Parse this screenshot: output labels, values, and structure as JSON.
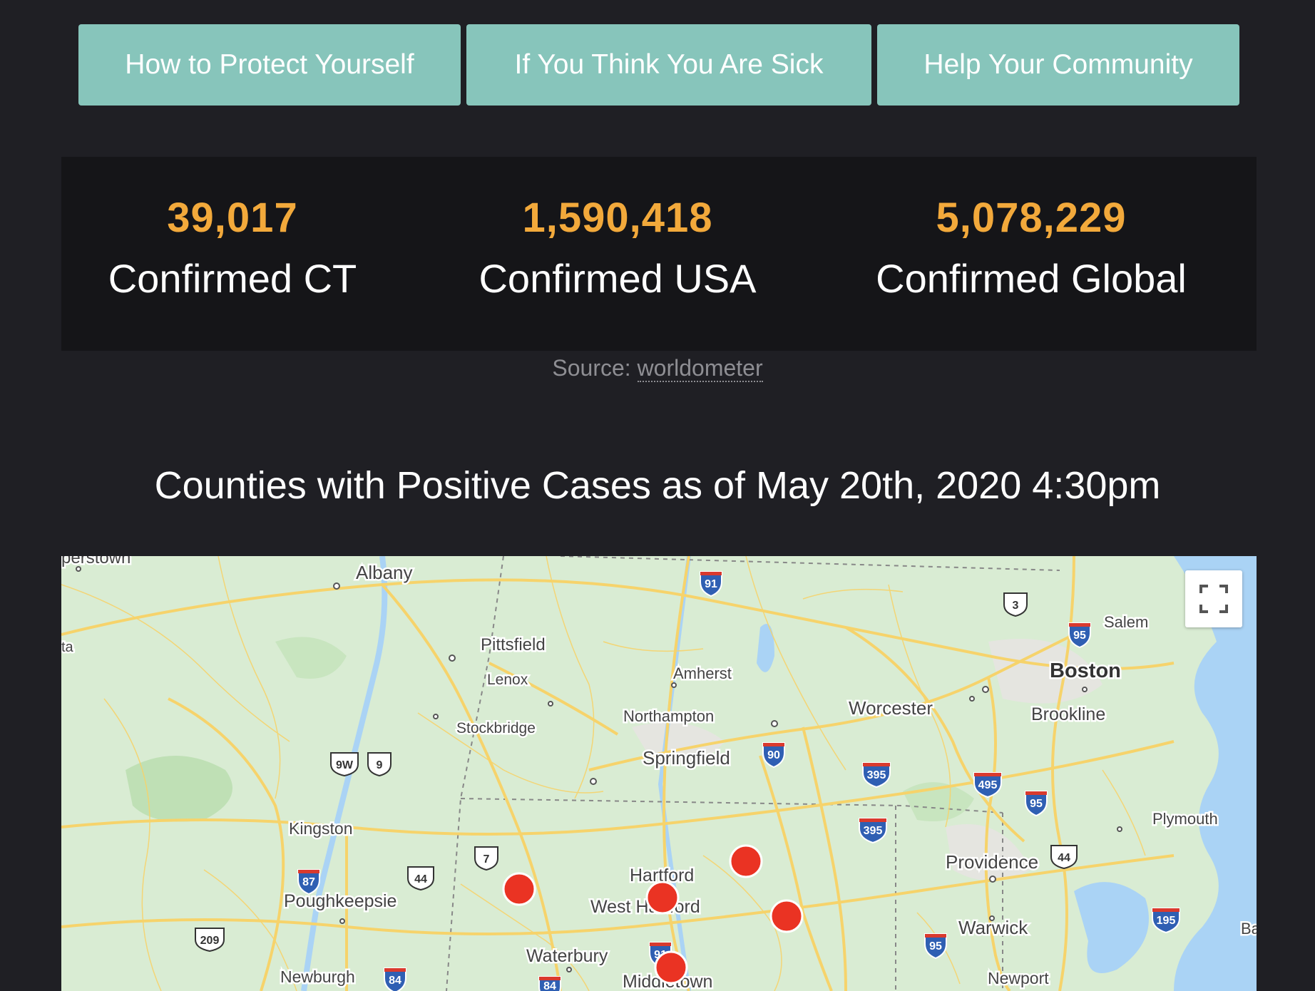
{
  "nav": {
    "buttons": [
      {
        "label": "How to Protect Yourself"
      },
      {
        "label": "If You Think You Are Sick"
      },
      {
        "label": "Help Your Community"
      }
    ]
  },
  "stats": [
    {
      "value": "39,017",
      "label": "Confirmed CT"
    },
    {
      "value": "1,590,418",
      "label": "Confirmed USA"
    },
    {
      "value": "5,078,229",
      "label": "Confirmed Global"
    }
  ],
  "source": {
    "prefix": "Source: ",
    "link_text": "worldometer"
  },
  "map": {
    "title": "Counties with Positive Cases as of May 20th, 2020 4:30pm",
    "cities": {
      "cooperstown": "perstown",
      "albany": "Albany",
      "pittsfield": "Pittsfield",
      "lenox": "Lenox",
      "stockbridge": "Stockbridge",
      "amherst": "Amherst",
      "northampton": "Northampton",
      "springfield": "Springfield",
      "worcester": "Worcester",
      "salem": "Salem",
      "boston": "Boston",
      "brookline": "Brookline",
      "kingston": "Kingston",
      "poughkeepsie": "Poughkeepsie",
      "newburgh": "Newburgh",
      "hartford": "Hartford",
      "west_hartford": "West Hartford",
      "waterbury": "Waterbury",
      "middletown": "Middletown",
      "providence": "Providence",
      "warwick": "Warwick",
      "newport": "Newport",
      "plymouth": "Plymouth",
      "left_edge": "ta",
      "right_edge": "Ba"
    },
    "shields": {
      "i91_north": "91",
      "us3": "3",
      "i95_salem": "95",
      "us9w": "9W",
      "us9": "9",
      "i90": "90",
      "i395_a": "395",
      "i495": "495",
      "i95_mid": "95",
      "i395_b": "395",
      "us7": "7",
      "us44_west": "44",
      "us44_east": "44",
      "i87": "87",
      "i195": "195",
      "us209": "209",
      "i95_sw": "95",
      "i84_west": "84",
      "i91_south": "91",
      "i84_south": "84"
    },
    "marker_color": "#ea3323",
    "water_color": "#aad3f5",
    "land_color": "#d9ecd3",
    "road_color": "#f6d36b"
  }
}
